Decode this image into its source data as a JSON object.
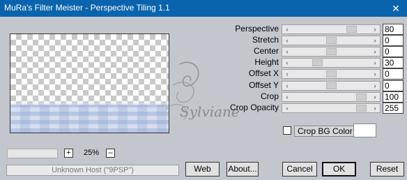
{
  "window": {
    "title": "MuRa's Filter Meister - Perspective Tiling 1.1",
    "close_glyph": "✕"
  },
  "preview": {
    "zoom_value": "25%",
    "zoom_in_glyph": "+",
    "zoom_out_glyph": "–"
  },
  "status_text": "Unknown Host (\"9PSP\")",
  "params": [
    {
      "label": "Perspective",
      "value": "80",
      "position": 0.8
    },
    {
      "label": "Stretch",
      "value": "0",
      "position": 0.5
    },
    {
      "label": "Center",
      "value": "0",
      "position": 0.5
    },
    {
      "label": "Height",
      "value": "30",
      "position": 0.3
    },
    {
      "label": "Offset X",
      "value": "0",
      "position": 0.5
    },
    {
      "label": "Offset Y",
      "value": "0",
      "position": 0.5
    },
    {
      "label": "Crop",
      "value": "100",
      "position": 0.95
    },
    {
      "label": "Crop Opacity",
      "value": "255",
      "position": 0.95
    }
  ],
  "crop_bg": {
    "label": "Crop BG Color",
    "checked": false,
    "color": "#ffffff"
  },
  "buttons": {
    "web": "Web",
    "about": "About...",
    "cancel": "Cancel",
    "ok": "OK",
    "reset": "Reset"
  },
  "watermark_text": "Sylviane",
  "colors": {
    "titlebar": "#0a64ad",
    "background": "#c3c6cd"
  }
}
